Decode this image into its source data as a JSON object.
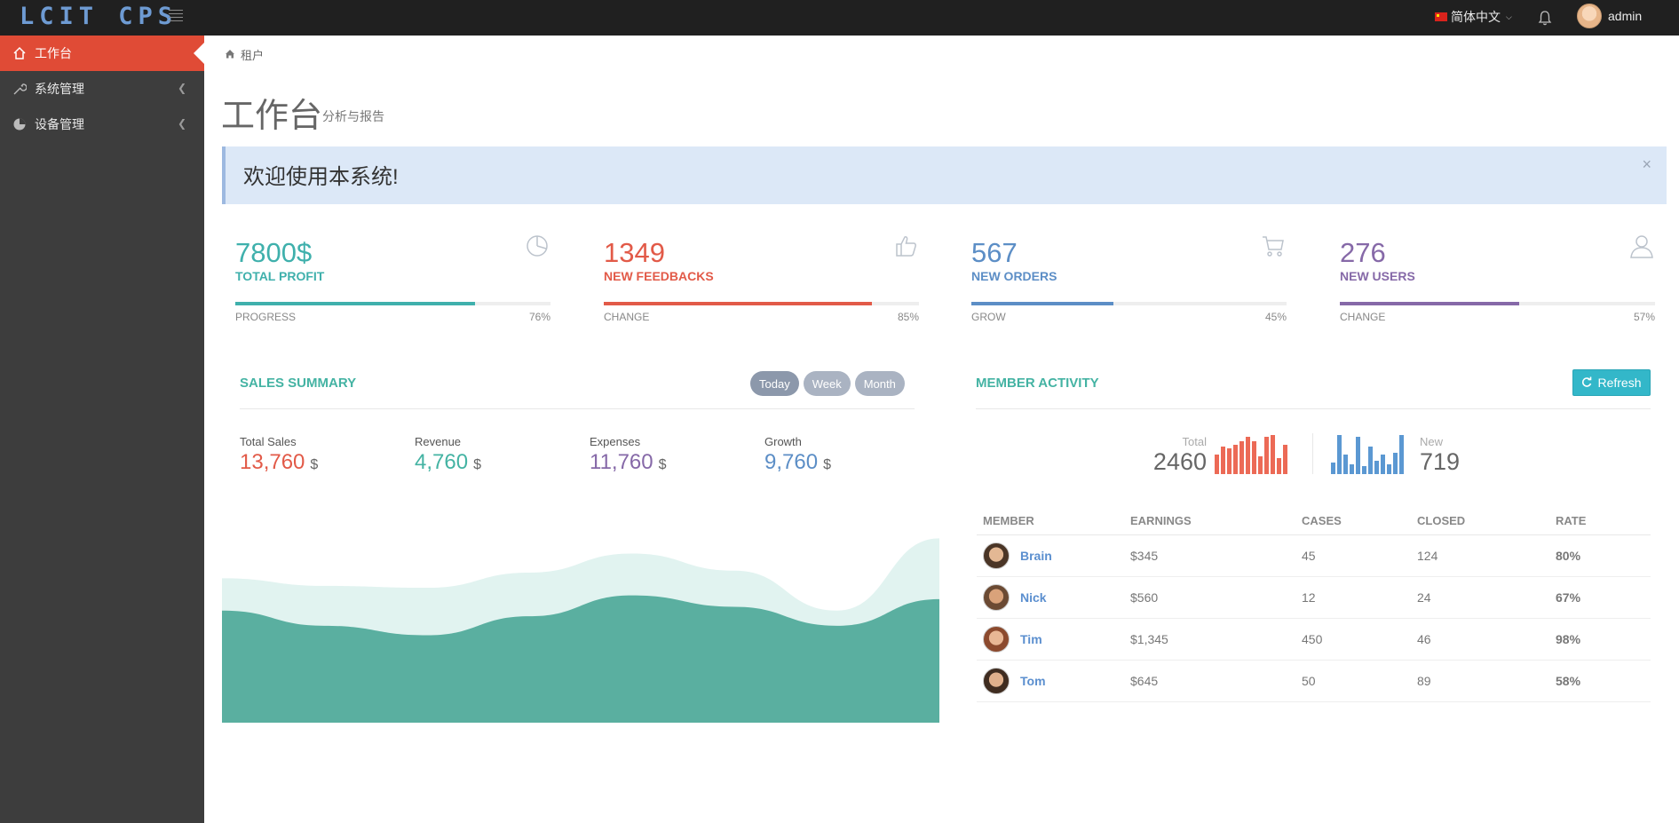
{
  "app": {
    "logo": "LCIT CPS"
  },
  "topbar": {
    "language": "简体中文",
    "username": "admin",
    "icons": [
      "menu-icon",
      "flag-cn-icon",
      "bell-icon"
    ]
  },
  "sidebar": {
    "items": [
      {
        "label": "工作台",
        "icon": "home-icon",
        "active": true
      },
      {
        "label": "系统管理",
        "icon": "wrench-icon"
      },
      {
        "label": "设备管理",
        "icon": "pie-chart-icon"
      }
    ]
  },
  "breadcrumb": {
    "label": "租户"
  },
  "page": {
    "title": "工作台",
    "subtitle": "分析与报告"
  },
  "alert": {
    "text": "欢迎使用本系统!",
    "close": "×"
  },
  "stats": [
    {
      "value": "7800$",
      "label": "TOTAL PROFIT",
      "footer": "PROGRESS",
      "percent_text": "76%",
      "percent": 0.76,
      "color": "#3fb0ac",
      "icon": "pie-icon"
    },
    {
      "value": "1349",
      "label": "NEW FEEDBACKS",
      "footer": "CHANGE",
      "percent_text": "85%",
      "percent": 0.85,
      "color": "#e25a48",
      "icon": "thumbs-up-icon"
    },
    {
      "value": "567",
      "label": "NEW ORDERS",
      "footer": "GROW",
      "percent_text": "45%",
      "percent": 0.45,
      "color": "#5c8ec6",
      "icon": "cart-icon"
    },
    {
      "value": "276",
      "label": "NEW USERS",
      "footer": "CHANGE",
      "percent_text": "57%",
      "percent": 0.57,
      "color": "#8669a8",
      "icon": "user-icon"
    }
  ],
  "sales": {
    "title": "SALES SUMMARY",
    "tabs": [
      {
        "label": "Today",
        "active": true
      },
      {
        "label": "Week"
      },
      {
        "label": "Month"
      }
    ],
    "items": [
      {
        "label": "Total Sales",
        "value": "13,760",
        "currency": "$",
        "color": "#e25a48"
      },
      {
        "label": "Revenue",
        "value": "4,760",
        "currency": "$",
        "color": "#44b3a3"
      },
      {
        "label": "Expenses",
        "value": "11,760",
        "currency": "$",
        "color": "#8669a8"
      },
      {
        "label": "Growth",
        "value": "9,760",
        "currency": "$",
        "color": "#5c8ec6"
      }
    ]
  },
  "chart_data": {
    "type": "area",
    "title": "",
    "xlabel": "",
    "ylabel": "",
    "grid": false,
    "series": [
      {
        "values": [
          0.76,
          0.72,
          0.71,
          0.79,
          0.89,
          0.8,
          0.59,
          0.97
        ],
        "color": "#e1f3f0"
      },
      {
        "values": [
          0.59,
          0.51,
          0.46,
          0.56,
          0.67,
          0.61,
          0.51,
          0.65
        ],
        "color": "#5aafa0"
      }
    ],
    "ylim": [
      0,
      1
    ]
  },
  "activity": {
    "title": "MEMBER ACTIVITY",
    "refresh_label": "Refresh",
    "total": {
      "label": "Total",
      "value": "2460",
      "bars": [
        0.5,
        0.7,
        0.65,
        0.75,
        0.85,
        0.95,
        0.85,
        0.45,
        0.95,
        1.0,
        0.4,
        0.75
      ],
      "color": "#ec6a56"
    },
    "new": {
      "label": "New",
      "value": "719",
      "bars": [
        0.3,
        1.0,
        0.5,
        0.25,
        0.95,
        0.2,
        0.7,
        0.35,
        0.5,
        0.25,
        0.55,
        1.0
      ],
      "color": "#5b98d2"
    },
    "columns": [
      "MEMBER",
      "EARNINGS",
      "CASES",
      "CLOSED",
      "RATE"
    ],
    "rows": [
      {
        "name": "Brain",
        "earnings": "$345",
        "cases": "45",
        "closed": "124",
        "rate": "80%"
      },
      {
        "name": "Nick",
        "earnings": "$560",
        "cases": "12",
        "closed": "24",
        "rate": "67%"
      },
      {
        "name": "Tim",
        "earnings": "$1,345",
        "cases": "450",
        "closed": "46",
        "rate": "98%"
      },
      {
        "name": "Tom",
        "earnings": "$645",
        "cases": "50",
        "closed": "89",
        "rate": "58%"
      }
    ]
  }
}
